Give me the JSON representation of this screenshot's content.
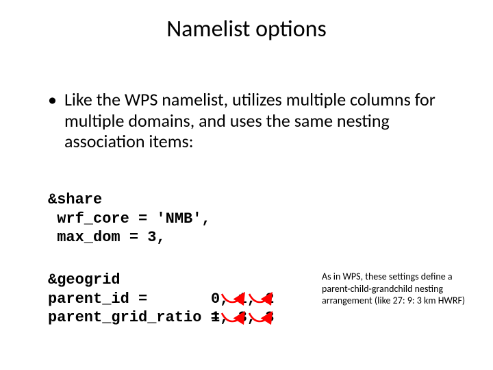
{
  "title": "Namelist options",
  "bullet": "Like the WPS namelist, utilizes multiple columns for multiple domains, and uses the same nesting association items:",
  "code": {
    "share": "&share\n wrf_core = 'NMB',\n max_dom = 3,",
    "geogrid_keys": "&geogrid\nparent_id =\nparent_grid_ratio =",
    "geogrid_vals": "\n0, 1, 2\n1, 3, 3"
  },
  "annotation": "As in WPS, these settings define a parent-child-grandchild nesting arrangement (like 27: 9: 3 km HWRF)",
  "arrow_color": "#ff0000"
}
